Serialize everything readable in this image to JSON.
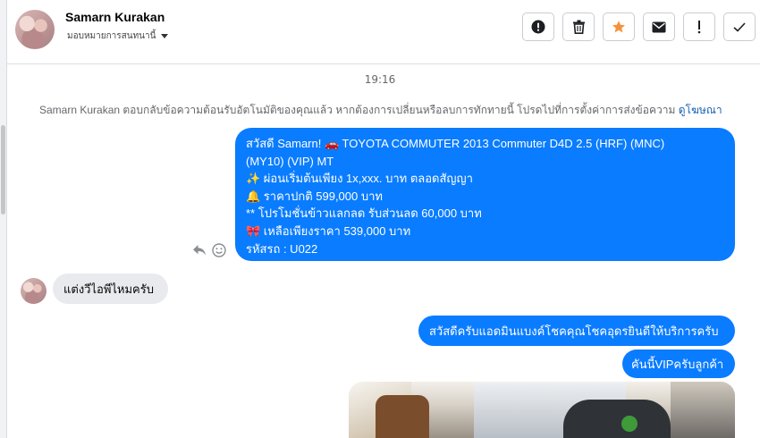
{
  "header": {
    "contact_name": "Samarn Kurakan",
    "assign_label": "มอบหมายการสนทนานี้"
  },
  "actions": [
    {
      "name": "report-button",
      "icon": "exclamation-circle-icon",
      "color": "#1c1e21"
    },
    {
      "name": "delete-button",
      "icon": "trash-icon",
      "color": "#1c1e21"
    },
    {
      "name": "star-button",
      "icon": "star-icon",
      "color": "#f7923a"
    },
    {
      "name": "mark-unread-button",
      "icon": "envelope-icon",
      "color": "#1c1e21"
    },
    {
      "name": "important-button",
      "icon": "exclamation-icon",
      "color": "#1c1e21"
    },
    {
      "name": "done-button",
      "icon": "check-icon",
      "color": "#1c1e21"
    }
  ],
  "conversation": {
    "timestamp": "19:16",
    "system_message": "Samarn Kurakan ตอบกลับข้อความต้อนรับอัตโนมัติของคุณแล้ว หากต้องการเปลี่ยนหรือลบการทักทายนี้ โปรดไปที่การตั้งค่าการส่งข้อความ",
    "system_link": "ดูโฆษณา",
    "outgoing_main_lines": [
      "สวัสดี Samarn! 🚗 TOYOTA COMMUTER 2013 Commuter D4D 2.5 (HRF) (MNC)",
      "(MY10) (VIP) MT",
      "✨ ผ่อนเริ่มต้นเพียง 1x,xxx. บาท ตลอดสัญญา",
      "🔔 ราคาปกติ 599,000 บาท",
      "** โปรโมชั่นข้าวแลกลด รับส่วนลด 60,000 บาท",
      "🎀 เหลือเพียงราคา 539,000 บาท",
      " รหัสรถ : U022"
    ],
    "incoming_message": "แต่งวีไอพีไหมครับ",
    "outgoing_reply_1": "สวัสดีครับแอดมินแบงค์โชคคุณโชคอุดรยินดีให้บริการครับ",
    "outgoing_reply_2": "คันนี้VIPครับลูกค้า"
  },
  "colors": {
    "outgoing_bubble": "#0a7cff",
    "incoming_bubble": "#e9eaed",
    "link": "#1a5fb4"
  }
}
